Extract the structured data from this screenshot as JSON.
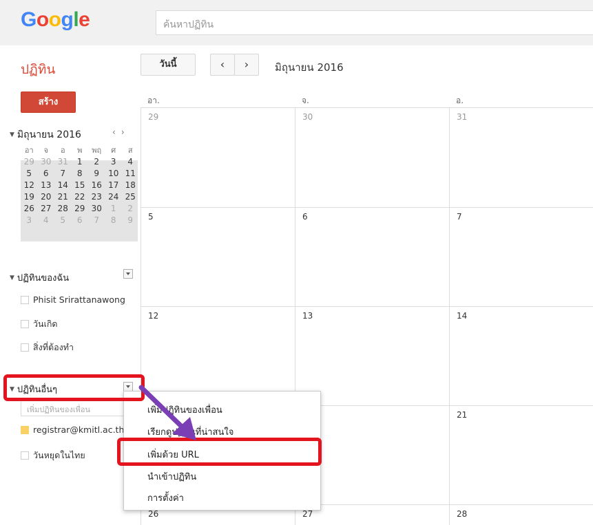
{
  "header": {
    "logo_letters": [
      {
        "ch": "G",
        "color": "#4285f4"
      },
      {
        "ch": "o",
        "color": "#ea4335"
      },
      {
        "ch": "o",
        "color": "#fbbc05"
      },
      {
        "ch": "g",
        "color": "#4285f4"
      },
      {
        "ch": "l",
        "color": "#34a853"
      },
      {
        "ch": "e",
        "color": "#ea4335"
      }
    ],
    "search_placeholder": "ค้นหาปฏิทิน"
  },
  "toolbar": {
    "app_title": "ปฏิทิน",
    "today_label": "วันนี้",
    "prev_icon": "‹",
    "next_icon": "›",
    "current_month": "มิถุนายน 2016"
  },
  "sidebar": {
    "create_label": "สร้าง",
    "mini_calendar": {
      "title": "มิถุนายน 2016",
      "nav_prev": "‹",
      "nav_next": "›",
      "weekdays": [
        "อา",
        "จ",
        "อ",
        "พ",
        "พฤ",
        "ศ",
        "ส"
      ],
      "weeks": [
        [
          "29",
          "30",
          "31",
          "1",
          "2",
          "3",
          "4"
        ],
        [
          "5",
          "6",
          "7",
          "8",
          "9",
          "10",
          "11"
        ],
        [
          "12",
          "13",
          "14",
          "15",
          "16",
          "17",
          "18"
        ],
        [
          "19",
          "20",
          "21",
          "22",
          "23",
          "24",
          "25"
        ],
        [
          "26",
          "27",
          "28",
          "29",
          "30",
          "1",
          "2"
        ],
        [
          "3",
          "4",
          "5",
          "6",
          "7",
          "8",
          "9"
        ]
      ]
    },
    "my_calendars": {
      "title": "ปฏิทินของฉัน",
      "items": [
        "Phisit Srirattanawong",
        "วันเกิด",
        "สิ่งที่ต้องทำ"
      ]
    },
    "other_calendars": {
      "title": "ปฏิทินอื่นๆ",
      "friend_placeholder": "เพิ่มปฏิทินของเพื่อน",
      "items": [
        "registrar@kmitl.ac.th",
        "วันหยุดในไทย"
      ]
    }
  },
  "grid": {
    "weekdays": [
      "อา.",
      "จ.",
      "อ."
    ],
    "weeks": [
      [
        "29",
        "30",
        "31"
      ],
      [
        "5",
        "6",
        "7"
      ],
      [
        "12",
        "13",
        "14"
      ],
      [
        "",
        "",
        "21"
      ],
      [
        "26",
        "27",
        "28"
      ]
    ]
  },
  "menu": {
    "items": [
      "เพิ่มปฏิทินของเพื่อน",
      "เรียกดูปฏิทินที่น่าสนใจ",
      "เพิ่มด้วย URL",
      "นำเข้าปฏิทิน",
      "การตั้งค่า"
    ]
  },
  "annotation_color": "#e4141e",
  "arrow_color": "#7b3fb5"
}
